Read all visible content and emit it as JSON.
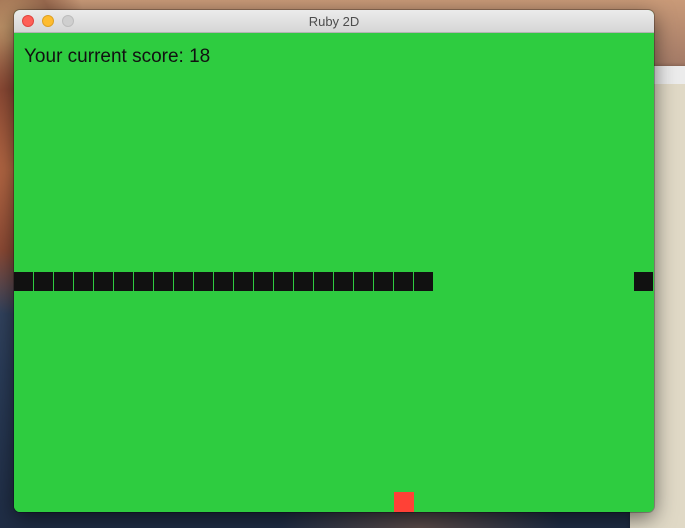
{
  "window": {
    "title": "Ruby 2D",
    "controls": {
      "close": "close-icon",
      "minimize": "minimize-icon",
      "zoom": "zoom-icon"
    }
  },
  "game": {
    "score_label": "Your current score: 18",
    "score": 18,
    "colors": {
      "background": "#2ecc40",
      "snake": "#111111",
      "food": "#ff4136"
    },
    "grid": {
      "cols": 32,
      "rows": 24
    },
    "snake_cells": [
      [
        0,
        12
      ],
      [
        1,
        12
      ],
      [
        2,
        12
      ],
      [
        3,
        12
      ],
      [
        4,
        12
      ],
      [
        5,
        12
      ],
      [
        6,
        12
      ],
      [
        7,
        12
      ],
      [
        8,
        12
      ],
      [
        9,
        12
      ],
      [
        10,
        12
      ],
      [
        11,
        12
      ],
      [
        12,
        12
      ],
      [
        13,
        12
      ],
      [
        14,
        12
      ],
      [
        15,
        12
      ],
      [
        16,
        12
      ],
      [
        17,
        12
      ],
      [
        18,
        12
      ],
      [
        19,
        12
      ],
      [
        20,
        12
      ],
      [
        31,
        12
      ]
    ],
    "food_cell": [
      19,
      23
    ]
  }
}
